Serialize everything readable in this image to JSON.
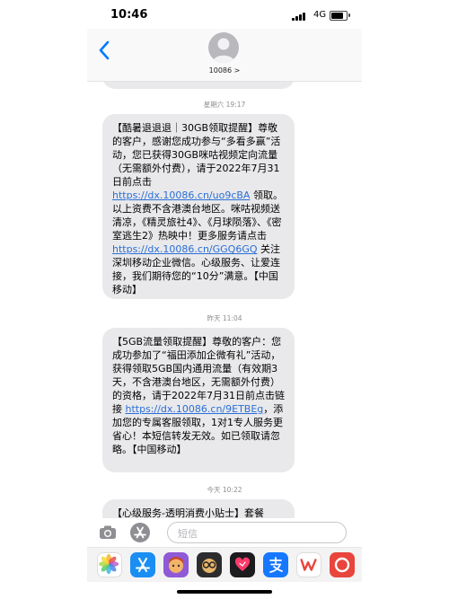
{
  "status_bar": {
    "time": "10:46",
    "network": "4G",
    "battery_level": 0.8
  },
  "header": {
    "contact_name": "10086 >"
  },
  "conversation": {
    "timestamps": [
      "星期六 19:17",
      "昨天 11:04",
      "今天 10:22"
    ],
    "messages": [
      {
        "parts": [
          {
            "text": "【酷暑退退退｜30GB领取提醒】尊敬的客户，感谢您成功参与“多看多赢”活动，您已获得30GB咪咕视频定向流量（无需额外付费），请于2022年7月31日前点击 "
          },
          {
            "link": "https://dx.10086.cn/uo9cBA"
          },
          {
            "text": " 领取。以上资费不含港澳台地区。咪咕视频送清凉，《精灵旅社4》、《月球陨落》、《密室逃生2》热映中！更多服务请点击 "
          },
          {
            "link": "https://dx.10086.cn/GGQ6GQ"
          },
          {
            "text": " 关注深圳移动企业微信。心级服务、让爱连接，我们期待您的“10分”满意。【中国移动】"
          }
        ]
      },
      {
        "parts": [
          {
            "text": "【5GB流量领取提醒】尊敬的客户：您成功参加了“福田添加企微有礼”活动，获得领取5GB国内通用流量（有效期3天，不含港澳台地区，无需额外付费）的资格，请于2022年7月31日前点击链接 "
          },
          {
            "link": "https://dx.10086.cn/9ETBEg"
          },
          {
            "text": "，添加您的专属客服领取，1对1专人服务更省心！本短信转发无效。如已领取请忽略。【中国移动】"
          }
        ]
      },
      {
        "parts": [
          {
            "text": "【心级服务-透明消费小贴士】套餐"
          }
        ]
      }
    ]
  },
  "composer": {
    "placeholder": "短信"
  },
  "app_strip": {
    "apps": [
      {
        "icon": "photos-icon",
        "color": "#ffffff"
      },
      {
        "icon": "app-store-icon",
        "color": "#1b8ef3"
      },
      {
        "icon": "memoji-icon",
        "color": "#8e5ad6"
      },
      {
        "icon": "memoji-glasses-icon",
        "color": "#2c2c2e"
      },
      {
        "icon": "digital-touch-icon",
        "color": "#1c1c1e"
      },
      {
        "icon": "alipay-icon",
        "color": "#1677ff"
      },
      {
        "icon": "wps-icon",
        "color": "#ffffff"
      },
      {
        "icon": "red-app-icon",
        "color": "#e8453c"
      }
    ]
  },
  "colors": {
    "bubble": "#e9e9eb",
    "link": "#2a6fd6",
    "accent": "#007aff",
    "send": "#34c759"
  }
}
